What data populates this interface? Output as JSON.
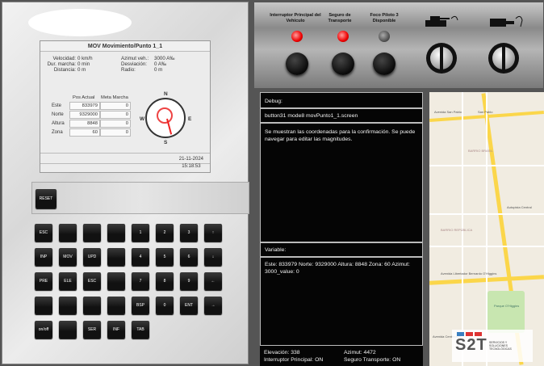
{
  "screen": {
    "title": "MOV  Movimiento/Punto 1_1",
    "velocidad_label": "Velocidad:",
    "velocidad_value": "0 km/h",
    "dur_label": "Dur. marcha:",
    "dur_value": "0 min",
    "distancia_label": "Distancia:",
    "distancia_value": "0 m",
    "azimut_label": "Azimut veh.:",
    "azimut_value": "3000 A‰",
    "desviacion_label": "Desviación:",
    "desviacion_value": "0 A‰",
    "radio_label": "Radio:",
    "radio_value": "0 m",
    "col_pos_actual": "Pos Actual",
    "col_meta_marcha": "Meta Marcha",
    "rows": [
      {
        "label": "Este",
        "pos": "833979",
        "meta": "0"
      },
      {
        "label": "Norte",
        "pos": "9329000",
        "meta": "0"
      },
      {
        "label": "Altura",
        "pos": "8848",
        "meta": "0"
      },
      {
        "label": "Zona",
        "pos": "60",
        "meta": "0"
      }
    ],
    "compass": {
      "n": "N",
      "s": "S",
      "e": "E",
      "w": "W"
    },
    "date": "21-11-2024",
    "time": "15:18:53"
  },
  "keypad": {
    "reset": "RESET",
    "row1": [
      "ESC",
      "",
      "",
      "",
      "1",
      "2",
      "3",
      "↑"
    ],
    "row2": [
      "INP",
      "MOV",
      "UPD",
      "",
      "4",
      "5",
      "6",
      "↓"
    ],
    "row3": [
      "PRE",
      "ELE",
      "ESC",
      "",
      "7",
      "8",
      "9",
      "←"
    ],
    "row4": [
      "",
      "",
      "",
      "",
      "BSP",
      "0",
      "ENT",
      "→"
    ],
    "row5": [
      "on/off",
      "",
      "SER",
      "INF",
      "TAB"
    ]
  },
  "controls": {
    "interruptor_label": "Interruptor Principal del Vehículo",
    "seguro_label": "Seguro de Transporte",
    "foco_label": "Foco Piloto 3 Disponible"
  },
  "debug": {
    "title": "Debug:",
    "screen_name": "button31 mode8 movPunto1_1.screen",
    "message": "Se muestran las coordenadas para la confirmación. Se puede navegar para editar las magnitudes.",
    "variable_title": "Variable:",
    "variable_text": "Este: 833979 Norte: 9329000 Altura: 8848 Zona: 60 Azimut: 3000_value: 0",
    "elevacion": "Elevación: 338",
    "azimut": "Azimut: 4472",
    "interruptor_status": "Interruptor Principal: ON",
    "seguro_status": "Seguro Transporte: ON"
  },
  "map": {
    "labels": [
      "Avenida San Pablo",
      "San Pablo",
      "BARRIO BRASIL",
      "Avenida Libertador Bernardo O'Higgins",
      "BARRIO REPÚBLICA",
      "Autopista Central",
      "Avenida Centenario",
      "Parque O'Higgins"
    ]
  },
  "logo": {
    "text": "S2T",
    "subtitle": "SERVICIOS Y SOLUCIONES TECNOLÓGICAS"
  },
  "colors": {
    "lamp_on": "#e00000",
    "lamp_off": "#555555",
    "debug_bg": "#050505",
    "map_road": "#fbd64a"
  }
}
